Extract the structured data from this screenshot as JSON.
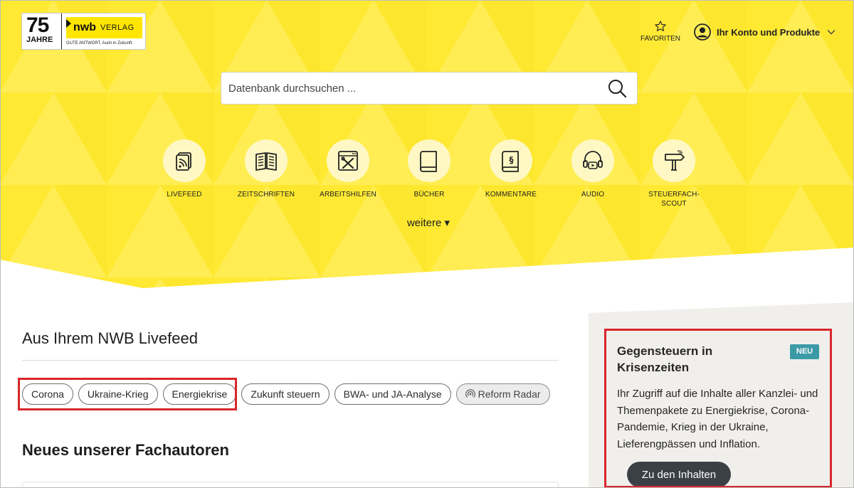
{
  "logo": {
    "anniversary_number": "75",
    "anniversary_word": "JAHRE",
    "brand": "nwb",
    "brand_suffix": "VERLAG",
    "tagline": "GUTE ANTWORT. Auch in Zukunft."
  },
  "header": {
    "favorites_label": "FAVORITEN",
    "account_label": "Ihr Konto und Produkte"
  },
  "search": {
    "placeholder": "Datenbank durchsuchen ..."
  },
  "categories": [
    {
      "label": "LIVEFEED",
      "icon": "livefeed-icon"
    },
    {
      "label": "ZEITSCHRIFTEN",
      "icon": "magazine-icon"
    },
    {
      "label": "ARBEITSHILFEN",
      "icon": "tools-icon"
    },
    {
      "label": "BÜCHER",
      "icon": "book-icon"
    },
    {
      "label": "KOMMENTARE",
      "icon": "paragraph-book-icon"
    },
    {
      "label": "AUDIO",
      "icon": "headphones-icon"
    },
    {
      "label": "STEUERFACH-\nSCOUT",
      "icon": "signpost-icon"
    }
  ],
  "more_label": "weitere ▾",
  "livefeed": {
    "heading": "Aus Ihrem NWB Livefeed",
    "tags": [
      "Corona",
      "Ukraine-Krieg",
      "Energiekrise",
      "Zukunft steuern",
      "BWA- und JA-Analyse",
      "Reform Radar"
    ]
  },
  "authors": {
    "heading": "Neues unserer Fachautoren"
  },
  "side_panel": {
    "title": "Gegensteuern in Krisenzeiten",
    "badge": "NEU",
    "text": "Ihr Zugriff auf die Inhalte aller Kanzlei- und Themenpakete zu Energiekrise, Corona-Pandemie, Krieg in der Ukraine, Lieferengpässen und Inflation.",
    "button_label": "Zu den Inhalten"
  },
  "colors": {
    "hero_yellow": "#ffe933",
    "icon_circle": "#fff8c5",
    "badge_teal": "#3c9aa6",
    "button_dark": "#3a4046",
    "highlight_red": "#d9262b"
  }
}
